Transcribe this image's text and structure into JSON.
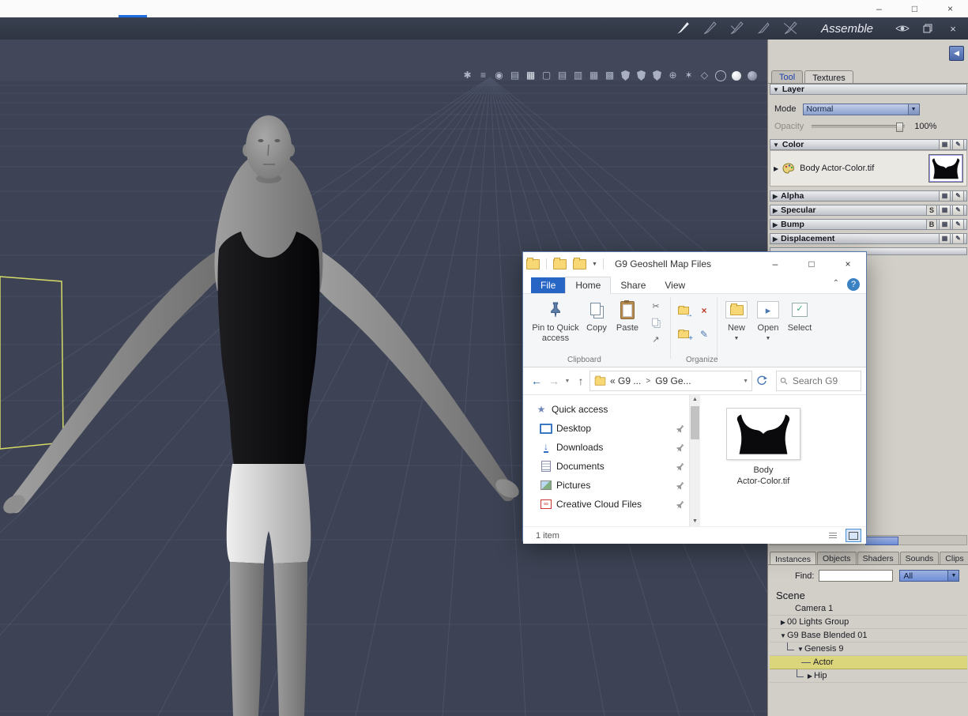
{
  "os": {
    "minimize": "–",
    "maximize": "□",
    "close": "×",
    "accent_color": "#1f6fe0"
  },
  "toolbar": {
    "mode_label": "Assemble",
    "close": "×"
  },
  "viewport": {
    "icons": [
      "paint-select-icon",
      "levels-icon",
      "motion-icon",
      "film-icon",
      "grid-icon",
      "layout-single-icon",
      "layout-rows-icon",
      "layout-columns-icon",
      "layout-grid-icon",
      "layout-mixed-icon",
      "shield-a-icon",
      "shield-b-icon",
      "shield-c-icon",
      "orbit-icon",
      "snow-icon",
      "wire-diamond-icon",
      "wire-sphere-icon",
      "shaded-sphere-icon",
      "textured-sphere-icon"
    ]
  },
  "panel": {
    "collapse_icon": "◀",
    "tabs": [
      {
        "label": "Tool"
      },
      {
        "label": "Textures"
      }
    ],
    "layer": {
      "title": "Layer",
      "mode_label": "Mode",
      "mode_value": "Normal",
      "opacity_label": "Opacity",
      "opacity_value": "100%"
    },
    "sections": {
      "color": {
        "title": "Color",
        "map": "Body Actor-Color.tif"
      },
      "alpha": {
        "title": "Alpha"
      },
      "specular": {
        "title": "Specular",
        "badge": "S"
      },
      "bump": {
        "title": "Bump",
        "badge": "B"
      },
      "displacement": {
        "title": "Displacement"
      }
    },
    "bottom_tabs": [
      {
        "label": "Instances"
      },
      {
        "label": "Objects"
      },
      {
        "label": "Shaders"
      },
      {
        "label": "Sounds"
      },
      {
        "label": "Clips"
      }
    ],
    "find_label": "Find:",
    "find_value": "",
    "filter_value": "All",
    "scene": {
      "title": "Scene",
      "items": [
        {
          "label": "Camera 1"
        },
        {
          "label": "00 Lights Group"
        },
        {
          "label": "G9 Base Blended 01"
        },
        {
          "label": "Genesis 9"
        },
        {
          "label": "Actor"
        },
        {
          "label": "Hip"
        }
      ]
    }
  },
  "explorer": {
    "title": "G9 Geoshell Map Files",
    "win": {
      "minimize": "–",
      "maximize": "□",
      "close": "×"
    },
    "tabs": [
      {
        "label": "File"
      },
      {
        "label": "Home"
      },
      {
        "label": "Share"
      },
      {
        "label": "View"
      }
    ],
    "help": "?",
    "ribbon": {
      "pin_line1": "Pin to Quick",
      "pin_line2": "access",
      "copy": "Copy",
      "paste": "Paste",
      "clipboard_group": "Clipboard",
      "organize_group": "Organize",
      "new": "New",
      "open": "Open",
      "select": "Select"
    },
    "address": {
      "crumb1": "« G9 ...",
      "sep": ">",
      "crumb2": "G9 Ge...",
      "search": "Search G9"
    },
    "nav": [
      {
        "label": "Quick access"
      },
      {
        "label": "Desktop"
      },
      {
        "label": "Downloads"
      },
      {
        "label": "Documents"
      },
      {
        "label": "Pictures"
      },
      {
        "label": "Creative Cloud Files"
      }
    ],
    "file": {
      "line1": "Body",
      "line2": "Actor-Color.tif"
    },
    "status": "1 item"
  }
}
